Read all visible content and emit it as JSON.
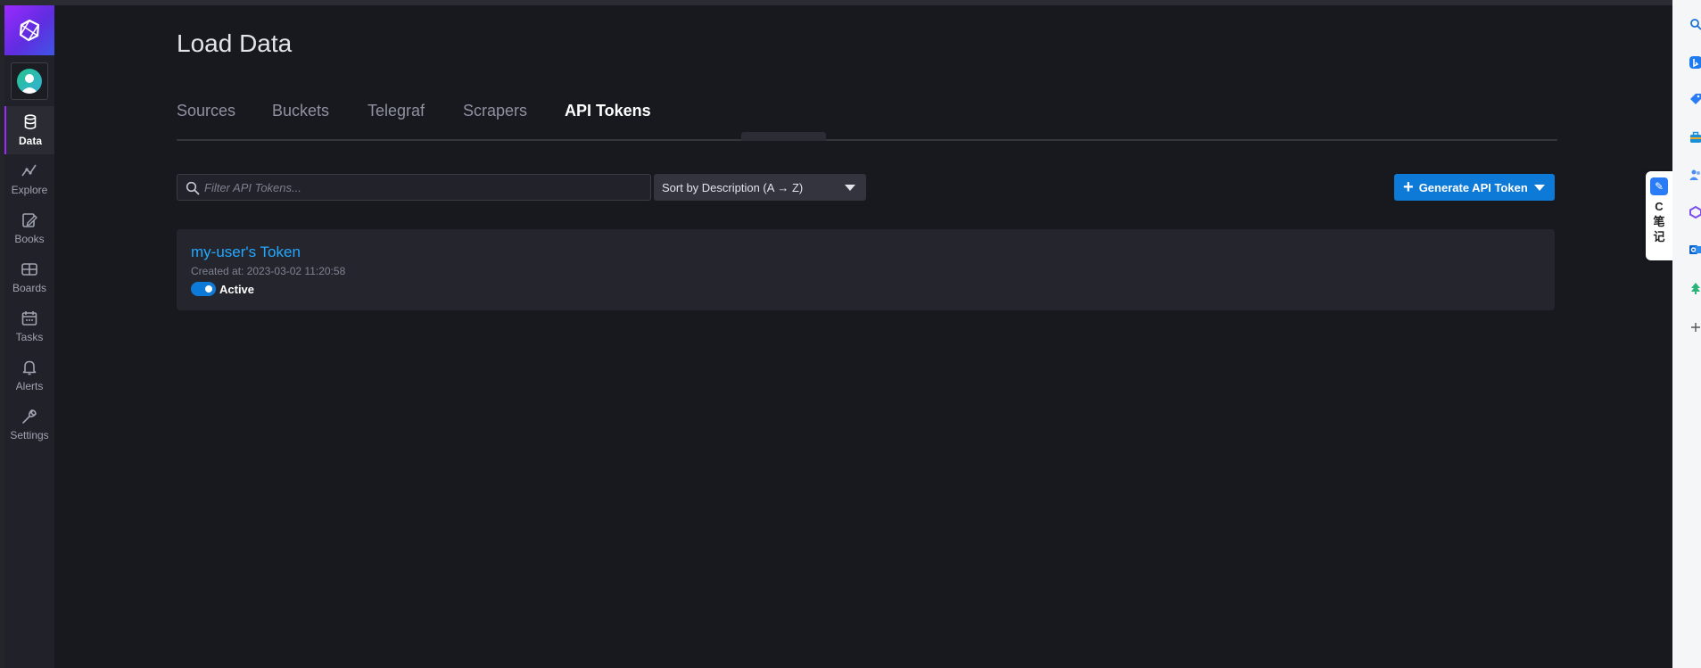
{
  "nav": {
    "items": [
      {
        "label": "Data",
        "icon": "database-icon"
      },
      {
        "label": "Explore",
        "icon": "graph-icon"
      },
      {
        "label": "Books",
        "icon": "notebook-icon"
      },
      {
        "label": "Boards",
        "icon": "dashboard-icon"
      },
      {
        "label": "Tasks",
        "icon": "calendar-icon"
      },
      {
        "label": "Alerts",
        "icon": "bell-icon"
      },
      {
        "label": "Settings",
        "icon": "wrench-icon"
      }
    ]
  },
  "page": {
    "title": "Load Data"
  },
  "tabs": [
    {
      "label": "Sources"
    },
    {
      "label": "Buckets"
    },
    {
      "label": "Telegraf"
    },
    {
      "label": "Scrapers"
    },
    {
      "label": "API Tokens",
      "active": true
    }
  ],
  "toolbar": {
    "search_placeholder": "Filter API Tokens...",
    "sort_label": "Sort by Description (A → Z)",
    "generate_label": "Generate API Token"
  },
  "tokens": [
    {
      "name": "my-user's Token",
      "created": "Created at: 2023-03-02 11:20:58",
      "status": "Active"
    }
  ],
  "note_widget": {
    "label": "C笔记"
  },
  "colors": {
    "accent": "#0d7ad8",
    "brand": "#9b2aff",
    "link": "#22a8ff",
    "background": "#18191f"
  }
}
